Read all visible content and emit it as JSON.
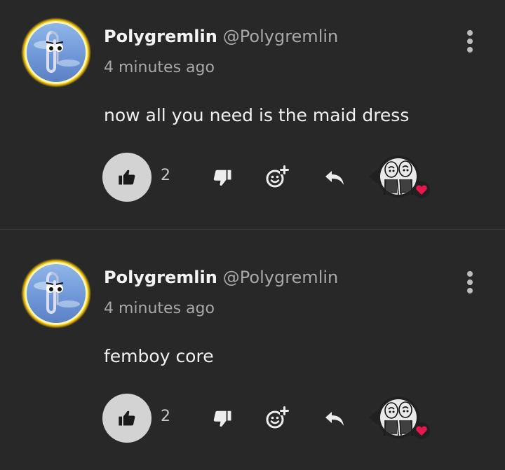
{
  "comments": [
    {
      "username": "Polygremlin",
      "handle": "@Polygremlin",
      "timestamp": "4 minutes ago",
      "text": "now all you need is the maid dress",
      "likes": "2"
    },
    {
      "username": "Polygremlin",
      "handle": "@Polygremlin",
      "timestamp": "4 minutes ago",
      "text": "femboy core",
      "likes": "2"
    }
  ],
  "icons": {
    "more": "more-vertical-icon",
    "like": "thumbs-up-icon",
    "dislike": "thumbs-down-icon",
    "emoji": "add-emoji-icon",
    "reply": "reply-icon",
    "heart": "heart-icon"
  },
  "colors": {
    "background": "#282828",
    "heart": "#e8174b",
    "like_button_bg": "#d3d3d3",
    "avatar_ring": "#f0d020"
  }
}
